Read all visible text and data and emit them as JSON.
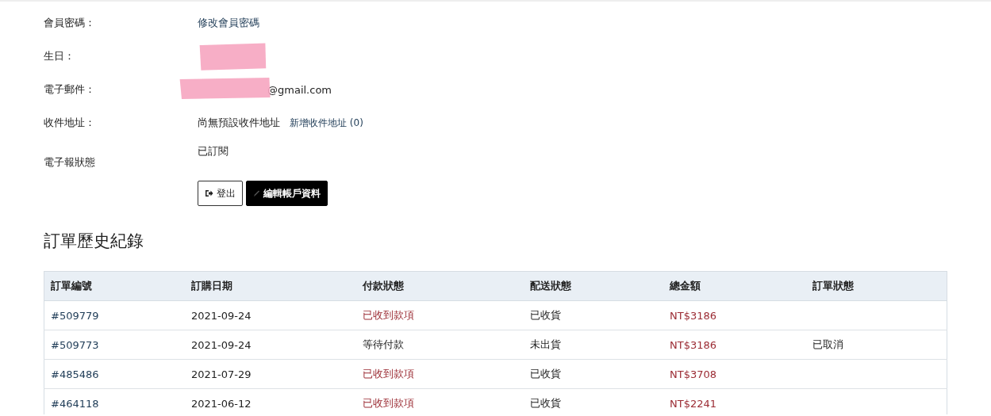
{
  "profile": [
    {
      "label": "會員密碼：",
      "kind": "link",
      "value": "修改會員密碼"
    },
    {
      "label": "生日：",
      "kind": "text",
      "redacted": true
    },
    {
      "label": "電子郵件：",
      "kind": "text",
      "value": "@gmail.com",
      "redacted": true
    },
    {
      "label": "收件地址：",
      "kind": "address",
      "value": "尚無預設收件地址",
      "link": "新增收件地址 (0)"
    },
    {
      "label": "電子報狀態",
      "kind": "text",
      "value": "已訂閱"
    }
  ],
  "buttons": [
    {
      "label": "登出",
      "kind": "logout"
    },
    {
      "label": "編輯帳戶資料",
      "kind": "edit"
    }
  ],
  "orders": {
    "title": "訂單歷史紀錄",
    "columns": [
      "訂單編號",
      "訂購日期",
      "付款狀態",
      "配送狀態",
      "總金額",
      "訂單狀態"
    ],
    "rows": [
      {
        "number": "#509779",
        "date": "2021-09-24",
        "payment": "已收到款項",
        "paid": true,
        "shipping": "已收貨",
        "total": "NT$3186"
      },
      {
        "number": "#509773",
        "date": "2021-09-24",
        "payment": "等待付款",
        "paid": false,
        "shipping": "未出貨",
        "total": "NT$3186",
        "status": "已取消"
      },
      {
        "number": "#485486",
        "date": "2021-07-29",
        "payment": "已收到款項",
        "paid": true,
        "shipping": "已收貨",
        "total": "NT$3708"
      },
      {
        "number": "#464118",
        "date": "2021-06-12",
        "payment": "已收到款項",
        "paid": true,
        "shipping": "已收貨",
        "total": "NT$2241"
      }
    ]
  }
}
